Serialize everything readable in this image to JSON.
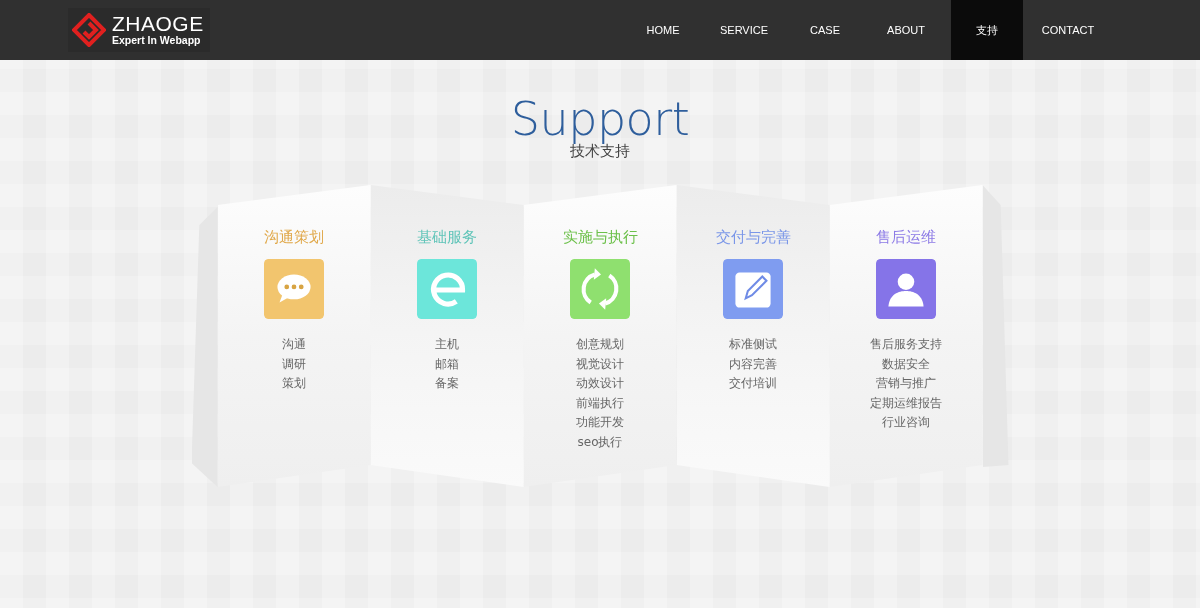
{
  "header": {
    "logo": {
      "name": "ZHAOGE",
      "tagline": "Expert In Webapp"
    },
    "nav": [
      {
        "label": "HOME",
        "selected": false
      },
      {
        "label": "SERVICE",
        "selected": false
      },
      {
        "label": "CASE",
        "selected": false
      },
      {
        "label": "ABOUT",
        "selected": false
      },
      {
        "label": "支持",
        "selected": true
      },
      {
        "label": "CONTACT",
        "selected": false
      }
    ]
  },
  "section": {
    "title": "Support",
    "subtitle": "技术支持"
  },
  "cards": [
    {
      "title": "沟通策划",
      "color": "#e0a84a",
      "kind": "chat",
      "items": [
        "沟通",
        "调研",
        "策划"
      ]
    },
    {
      "title": "基础服务",
      "color": "#5fc4b8",
      "kind": "letter",
      "items": [
        "主机",
        "邮箱",
        "备案"
      ]
    },
    {
      "title": "实施与执行",
      "color": "#6cc04a",
      "kind": "refresh",
      "items": [
        "创意规划",
        "视觉设计",
        "动效设计",
        "前端执行",
        "功能开发",
        "seo执行"
      ]
    },
    {
      "title": "交付与完善",
      "color": "#7a96e8",
      "kind": "edit",
      "items": [
        "标准侧试",
        "内容完善",
        "交付培训"
      ]
    },
    {
      "title": "售后运维",
      "color": "#8c7ae6",
      "kind": "person",
      "items": [
        "售后服务支持",
        "数据安全",
        "营销与推广",
        "定期运维报告",
        "行业咨询"
      ]
    }
  ]
}
